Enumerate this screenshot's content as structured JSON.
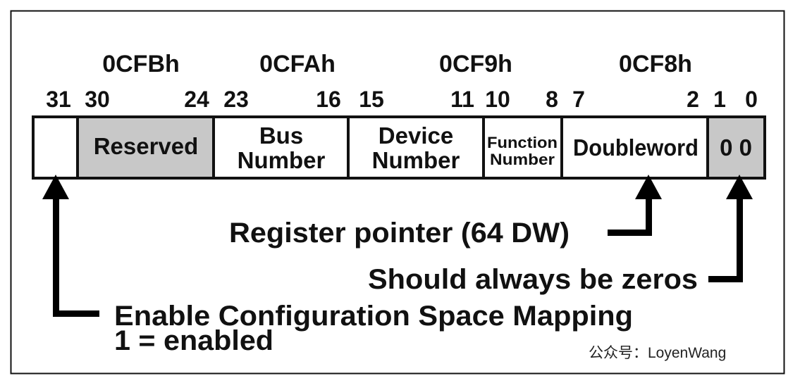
{
  "addresses": [
    "0CFBh",
    "0CFAh",
    "0CF9h",
    "0CF8h"
  ],
  "bits": [
    "31",
    "30",
    "24",
    "23",
    "16",
    "15",
    "11",
    "10",
    "8",
    "7",
    "2",
    "1",
    "0"
  ],
  "fields": {
    "enable": "",
    "reserved": "Reserved",
    "bus": [
      "Bus",
      "Number"
    ],
    "device": [
      "Device",
      "Number"
    ],
    "function": [
      "Function",
      "Number"
    ],
    "doubleword": "Doubleword",
    "zeros": "0 0"
  },
  "annotations": {
    "register_pointer": "Register pointer (64 DW)",
    "zeros": "Should always be zeros",
    "enable_line1": "Enable Configuration Space Mapping",
    "enable_line2": "1 = enabled"
  },
  "watermark": "公众号：LoyenWang",
  "colors": {
    "reserved_fill": "#c8c8c8",
    "line": "#111111"
  }
}
